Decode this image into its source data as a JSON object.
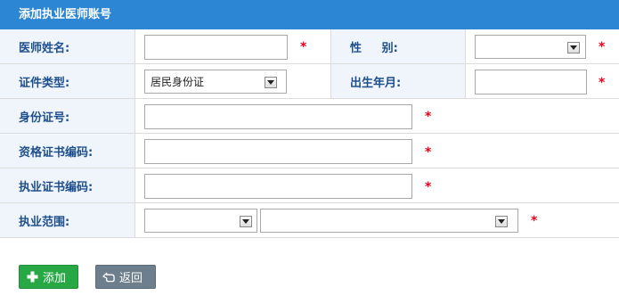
{
  "header": {
    "title": "添加执业医师账号"
  },
  "form": {
    "doctor_name": {
      "label": "医师姓名:",
      "value": "",
      "required": "*"
    },
    "gender": {
      "label": "性     别:",
      "value": "",
      "required": "*"
    },
    "id_type": {
      "label": "证件类型:",
      "value": "居民身份证"
    },
    "birth": {
      "label": "出生年月:",
      "value": "",
      "required": "*"
    },
    "id_number": {
      "label": "身份证号:",
      "value": "",
      "required": "*"
    },
    "qualification_no": {
      "label": "资格证书编码:",
      "value": "",
      "required": "*"
    },
    "practice_cert_no": {
      "label": "执业证书编码:",
      "value": "",
      "required": "*"
    },
    "practice_scope": {
      "label": "执业范围:",
      "value1": "",
      "value2": "",
      "required": "*"
    }
  },
  "actions": {
    "add_label": "添加",
    "back_label": "返回"
  },
  "colors": {
    "header_bg": "#2d86d3",
    "label_bg": "#f0f5fb",
    "label_text": "#1e4f8d",
    "required": "#e8001c",
    "add_btn": "#28a745",
    "back_btn": "#6d7e8c"
  }
}
